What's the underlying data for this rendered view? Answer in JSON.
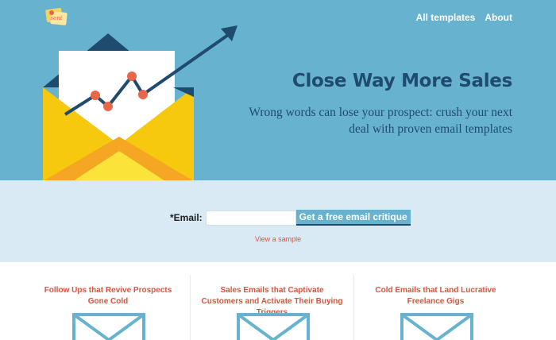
{
  "header": {
    "logo_text": "sent",
    "nav": [
      {
        "label": "All templates"
      },
      {
        "label": "About"
      }
    ]
  },
  "hero": {
    "headline": "Close Way More Sales",
    "subhead": "Wrong words can lose your prospect: crush your next deal with proven email templates"
  },
  "signup": {
    "email_label": "*Email:",
    "email_value": "",
    "email_placeholder": "",
    "button_label": "Get a free email critique",
    "sample_link": "View a sample"
  },
  "cards": [
    {
      "title": "Follow Ups that Revive Prospects Gone Cold",
      "icon": "envelope-icon"
    },
    {
      "title": "Sales Emails that Captivate Customers and Activate Their Buying Triggers",
      "icon": "envelope-icon"
    },
    {
      "title": "Cold Emails that Land Lucrative Freelance Gigs",
      "icon": "envelope-icon"
    }
  ],
  "colors": {
    "hero_bg": "#67b3cf",
    "signup_bg": "#d9eaf5",
    "navy": "#1f4c6e",
    "accent_red": "#e1513b",
    "envelope_yellow": "#f6c90e",
    "card_icon": "#67b3cf"
  }
}
